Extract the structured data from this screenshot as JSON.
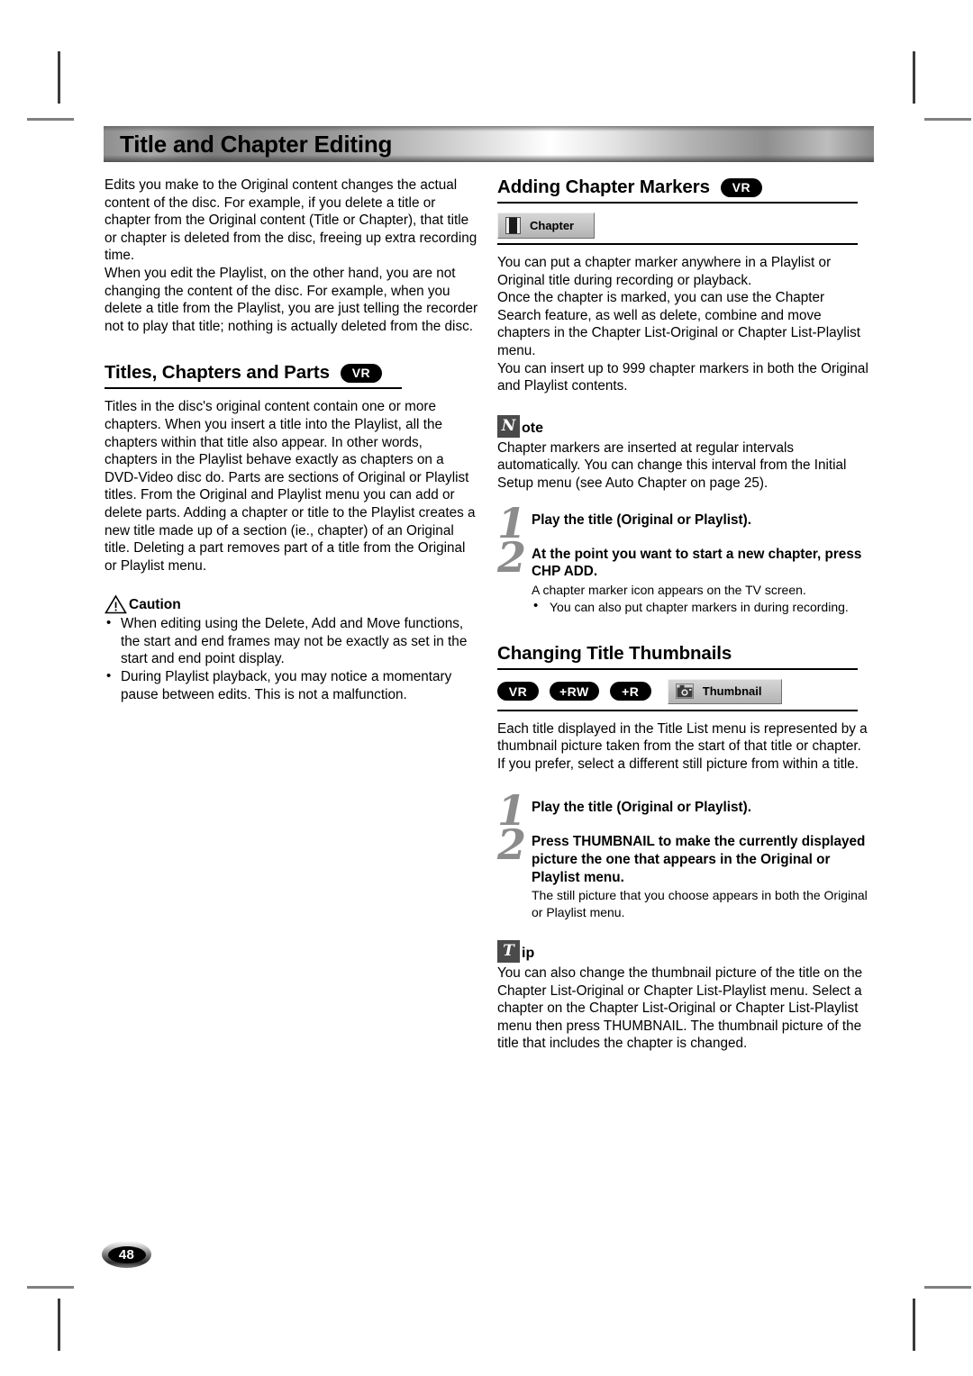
{
  "page": {
    "number": "48",
    "banner_title": "Title and Chapter Editing"
  },
  "left_column": {
    "intro_paragraph_1": "Edits you make to the Original content changes the actual content of the disc. For example, if you delete a title or chapter from the Original content (Title or Chapter), that title or chapter is deleted from the disc, freeing up extra recording time.",
    "intro_paragraph_2": "When you edit the Playlist, on the other hand, you are not changing the content of the disc. For example, when you delete a title from the Playlist, you are just telling the recorder not to play that title; nothing is actually deleted from the disc.",
    "section": {
      "heading": "Titles, Chapters and Parts",
      "badge": "VR",
      "paragraph": "Titles in the disc's original content contain one or more chapters. When you insert a title into the Playlist, all the chapters within that title also appear. In other words, chapters in the Playlist behave exactly as chapters on a DVD-Video disc do. Parts are sections of Original or Playlist titles. From the Original and Playlist menu you can add or delete parts. Adding a chapter or title to the Playlist creates a new title made up of a section (ie., chapter) of an Original title. Deleting a part removes part of a title from the Original or Playlist menu."
    },
    "caution": {
      "label": "Caution",
      "icon": "warning-triangle-icon",
      "items": [
        "When editing using the Delete, Add and Move functions, the start and end frames may not be exactly as set in the start and end point display.",
        "During Playlist playback, you may notice a momentary pause between edits. This is not a malfunction."
      ]
    }
  },
  "right_column": {
    "chapter_markers": {
      "heading": "Adding Chapter Markers",
      "badge": "VR",
      "osd_button": {
        "label": "Chapter",
        "icon": "film-strip-icon"
      },
      "paragraph_1": "You can put a chapter marker anywhere in a Playlist or Original title during recording or playback.",
      "paragraph_2": "Once the chapter is marked, you can use the Chapter Search feature, as well as delete, combine and move chapters in the Chapter List-Original or Chapter List-Playlist menu.",
      "paragraph_3": "You can insert up to 999 chapter markers in both the Original and Playlist contents.",
      "note": {
        "glyph": "N",
        "word": "ote",
        "text": "Chapter markers are inserted at regular intervals automatically. You can change this interval from the Initial Setup menu (see Auto Chapter on page 25)."
      },
      "steps": [
        {
          "number": "1",
          "title": "Play the title (Original or Playlist).",
          "sub": "",
          "bullets": []
        },
        {
          "number": "2",
          "title": "At the point you want to start a new chapter, press CHP ADD.",
          "sub": "A chapter marker icon appears on the TV screen.",
          "bullets": [
            "You can also put chapter markers in during recording."
          ]
        }
      ]
    },
    "thumbnails": {
      "heading": "Changing Title Thumbnails",
      "badges": [
        "VR",
        "+RW",
        "+R"
      ],
      "osd_button": {
        "label": "Thumbnail",
        "icon": "camera-icon"
      },
      "paragraph_1": "Each title displayed in the Title List menu is represented by a thumbnail picture taken from the start of that title or chapter.",
      "paragraph_2": "If you prefer, select a different still picture from within a title.",
      "steps": [
        {
          "number": "1",
          "title": "Play the title (Original or Playlist).",
          "sub": ""
        },
        {
          "number": "2",
          "title": "Press THUMBNAIL to make the currently displayed picture the one that appears in the Original or Playlist menu.",
          "sub": "The still picture that you choose appears in both the Original or Playlist menu."
        }
      ],
      "tip": {
        "glyph": "T",
        "word": "ip",
        "text": "You can also change the thumbnail picture of the title on the Chapter List-Original or Chapter List-Playlist menu. Select a chapter on the Chapter List-Original or Chapter List-Playlist menu then press THUMBNAIL. The thumbnail picture of the title that includes the chapter is changed."
      }
    }
  }
}
